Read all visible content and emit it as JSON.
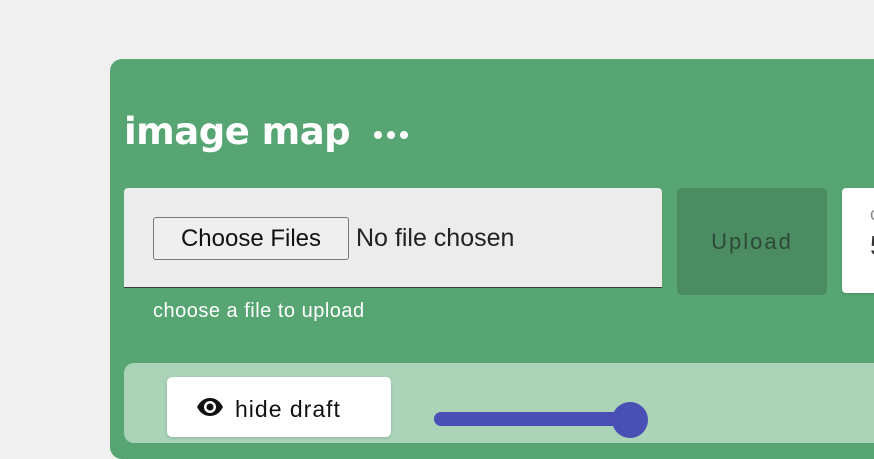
{
  "header": {
    "title": "image map",
    "menu_icon": "more-horizontal-icon"
  },
  "file_input": {
    "choose_label": "Choose Files",
    "status": "No file chosen",
    "helper_text": "choose a file to upload"
  },
  "upload": {
    "label": "Upload"
  },
  "side_card": {
    "fragment_top": "c",
    "fragment_bottom": "5"
  },
  "draft": {
    "toggle_label": "hide draft",
    "toggle_icon": "eye-icon"
  },
  "colors": {
    "panel": "#56a573",
    "draft_area": "#aad3b8",
    "upload_disabled": "#4b8c62",
    "slider": "#4a4fb5"
  }
}
